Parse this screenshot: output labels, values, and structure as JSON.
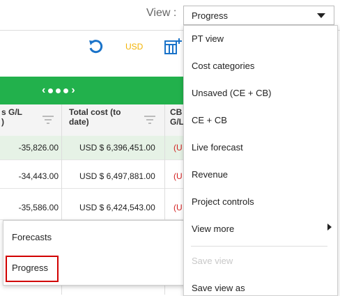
{
  "header": {
    "view_label": "View :",
    "view_selected": "Progress"
  },
  "toolbar": {
    "currency": "USD",
    "colors": {
      "undo": "#1a73c9",
      "currency": "#f2b200",
      "grid": "#1a73c9"
    }
  },
  "band": {
    "color": "#22b14c"
  },
  "table": {
    "headers": [
      {
        "line1": "s G/L",
        "line2": ")"
      },
      {
        "line1": "Total cost (to",
        "line2": "date)"
      },
      {
        "line1": "CB",
        "line2": "G/L"
      }
    ],
    "rows": [
      {
        "gl": "-35,826.00",
        "total": "USD $ 6,396,451.00",
        "cb": "(U"
      },
      {
        "gl": "-34,443.00",
        "total": "USD $ 6,497,881.00",
        "cb": "(U"
      },
      {
        "gl": "-35,586.00",
        "total": "USD $ 6,424,543.00",
        "cb": "(U"
      }
    ]
  },
  "menu": {
    "items": [
      "PT view",
      "Cost categories",
      "Unsaved (CE + CB)",
      "CE + CB",
      "Live forecast",
      "Revenue",
      "Project controls",
      "View more"
    ],
    "save_view": "Save view",
    "save_view_as": "Save view as"
  },
  "submenu": {
    "items": [
      "Forecasts",
      "Progress"
    ]
  }
}
